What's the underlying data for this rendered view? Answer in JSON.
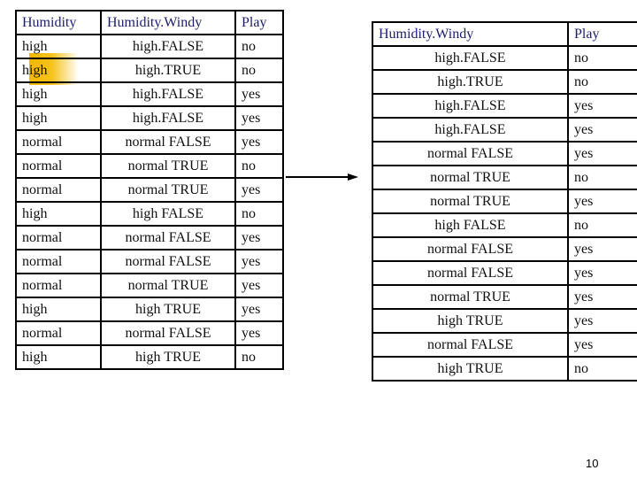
{
  "left_table": {
    "headers": [
      "Humidity",
      "Humidity.Windy",
      "Play"
    ],
    "rows": [
      [
        "high",
        "high.FALSE",
        "no"
      ],
      [
        "high",
        "high.TRUE",
        "no"
      ],
      [
        "high",
        "high.FALSE",
        "yes"
      ],
      [
        "high",
        "high.FALSE",
        "yes"
      ],
      [
        "normal",
        "normal FALSE",
        "yes"
      ],
      [
        "normal",
        "normal TRUE",
        "no"
      ],
      [
        "normal",
        "normal TRUE",
        "yes"
      ],
      [
        "high",
        "high FALSE",
        "no"
      ],
      [
        "normal",
        "normal FALSE",
        "yes"
      ],
      [
        "normal",
        "normal FALSE",
        "yes"
      ],
      [
        "normal",
        "normal TRUE",
        "yes"
      ],
      [
        "high",
        "high TRUE",
        "yes"
      ],
      [
        "normal",
        "normal FALSE",
        "yes"
      ],
      [
        "high",
        "high TRUE",
        "no"
      ]
    ]
  },
  "right_table": {
    "headers": [
      "Humidity.Windy",
      "Play"
    ],
    "rows": [
      [
        "high.FALSE",
        "no"
      ],
      [
        "high.TRUE",
        "no"
      ],
      [
        "high.FALSE",
        "yes"
      ],
      [
        "high.FALSE",
        "yes"
      ],
      [
        "normal FALSE",
        "yes"
      ],
      [
        "normal TRUE",
        "no"
      ],
      [
        "normal TRUE",
        "yes"
      ],
      [
        "high FALSE",
        "no"
      ],
      [
        "normal FALSE",
        "yes"
      ],
      [
        "normal FALSE",
        "yes"
      ],
      [
        "normal TRUE",
        "yes"
      ],
      [
        "high TRUE",
        "yes"
      ],
      [
        "normal FALSE",
        "yes"
      ],
      [
        "high TRUE",
        "no"
      ]
    ]
  },
  "arrow": {
    "icon": "right-arrow-icon"
  },
  "page_number": "10",
  "colors": {
    "header_text": "#1c1c6e",
    "highlight": "#f2b800",
    "border": "#000000"
  }
}
